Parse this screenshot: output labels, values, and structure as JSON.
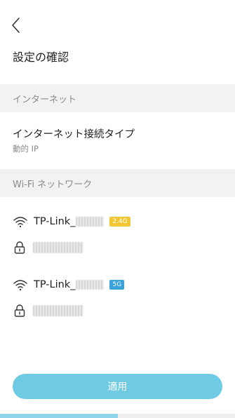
{
  "header": {
    "back_icon": "chevron-left-icon",
    "title": "設定の確認"
  },
  "internet": {
    "section_label": "インターネット",
    "connection_type_label": "インターネット接続タイプ",
    "connection_type_value": "動的 IP"
  },
  "wifi": {
    "section_label": "Wi-Fi ネットワーク",
    "networks": [
      {
        "ssid": "TP-Link_",
        "band": "2.4G",
        "band_color": "#f2c633",
        "icon": "wifi-icon",
        "lock_icon": "lock-icon"
      },
      {
        "ssid": "TP-Link_",
        "band": "5G",
        "band_color": "#3ba3dc",
        "icon": "wifi-icon",
        "lock_icon": "lock-icon"
      }
    ]
  },
  "footer": {
    "apply_label": "適用",
    "apply_color": "#6fcbe3",
    "progress": 0.5
  }
}
